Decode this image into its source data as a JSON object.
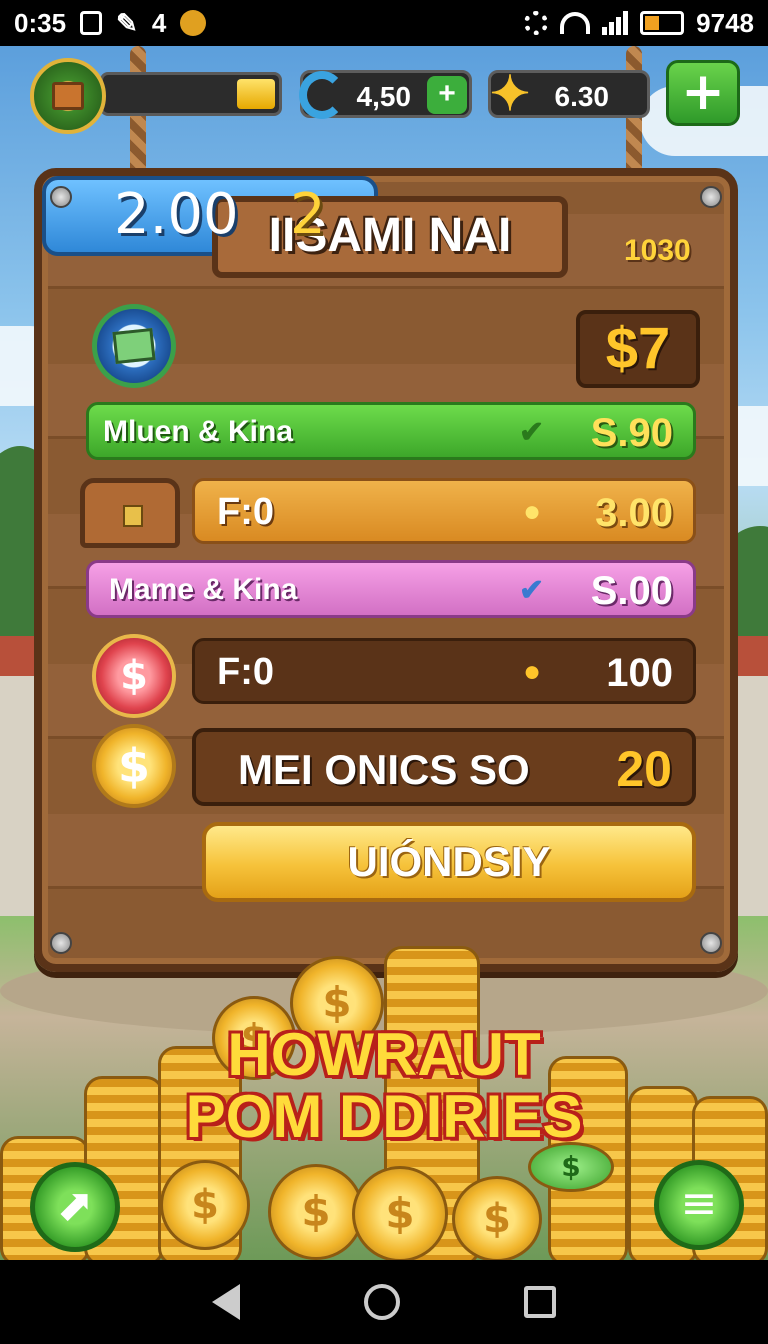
{
  "status_bar": {
    "time": "0:35",
    "left_extra": "4",
    "battery_text": "9748"
  },
  "hud": {
    "gems_value": "4,50",
    "stars_value": "6.30",
    "add_label": "+"
  },
  "board": {
    "title": "IISAMI NAI",
    "corner_number": "1030",
    "blue_value_1": "2.00",
    "blue_value_2": "2",
    "dark_price": "$7",
    "rows": [
      {
        "label": "Mluen & Kina",
        "check": "✔",
        "price": "S.90"
      },
      {
        "label": "F:0",
        "check": "●",
        "price": "3.00"
      },
      {
        "label": "Mame & Kina",
        "check": "✔",
        "price": "S.00"
      },
      {
        "label": "F:0",
        "check": "●",
        "price": "100"
      },
      {
        "label": "MEI ONICS SO",
        "price": "20"
      }
    ],
    "cta_label": "UIÓNDSIY"
  },
  "promo": {
    "line1": "HOWRAUT",
    "line2": "POM DDIRIES"
  },
  "colors": {
    "wood": "#8a5a32",
    "green": "#3da72a",
    "gold": "#f6c23a",
    "pink": "#d270c4",
    "blue": "#2f88d8"
  }
}
